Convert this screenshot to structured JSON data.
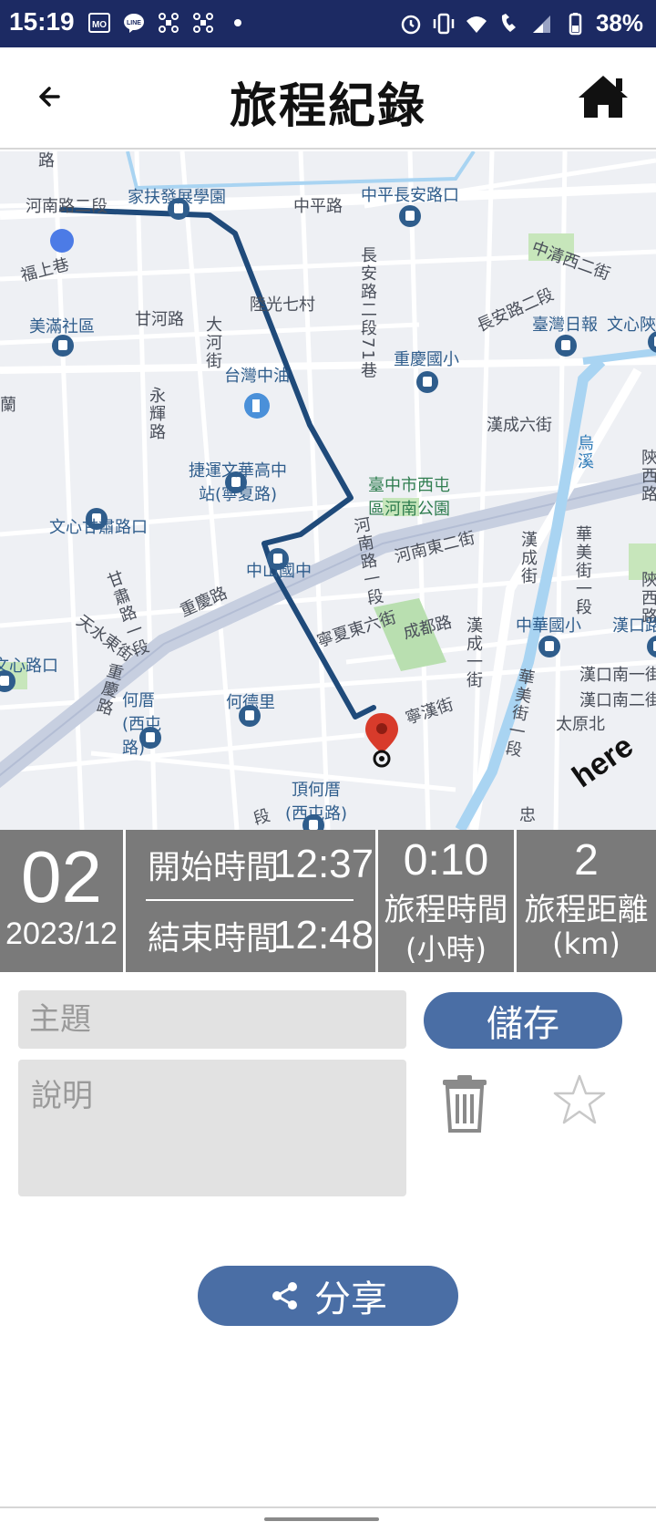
{
  "status_bar": {
    "time": "15:19",
    "battery": "38%",
    "icons": [
      "mo-icon",
      "line-icon",
      "drone-icon",
      "drone-icon",
      "dot-icon",
      "alarm-icon",
      "vibrate-icon",
      "wifi-icon",
      "wifi-call-icon",
      "signal-icon",
      "battery-icon"
    ]
  },
  "header": {
    "title": "旅程紀錄",
    "back_icon": "arrow-left-icon",
    "home_icon": "home-icon"
  },
  "map": {
    "labels": {
      "road_henan2": "河南路二段",
      "jiafu": "家扶發展學園",
      "zhongping": "中平路",
      "zhongping_changan": "中平長安路口",
      "fushang": "福上巷",
      "changan": "長安路二段71巷",
      "zhongqing": "中清西二街",
      "ganhe": "甘河路",
      "dahe": "大河街",
      "luguang": "陸光七村",
      "changan2": "長安路二段",
      "taiwan_daily": "臺灣日報",
      "wenxin_shan": "文心陝",
      "meiman": "美滿社區",
      "chongqing_elem": "重慶國小",
      "yonghui": "永輝路",
      "cpc": "台灣中油",
      "hanchen6": "漢成六街",
      "wuxi": "烏溪",
      "shanxi": "陝西路",
      "jieyun": "捷運文華高中站(寧夏路)",
      "park": "臺中市西屯區河南公園",
      "wenxin_gansu": "文心甘肅路口",
      "henan_e2": "河南東二街",
      "henan1": "河南路一段",
      "hancheng": "漢成街",
      "huamei": "華美街一段",
      "zhongshan": "中山國中",
      "gansu1": "甘肅路一段",
      "chongqing_rd": "重慶路",
      "tianshui_e": "天水東街",
      "ningxia_e6": "寧夏東六街",
      "chengdu": "成都路",
      "hancheng1": "漢成一街",
      "zhonghua_elem": "中華國小",
      "hankou": "漢口路",
      "wenxin_rd": "文心路口",
      "chongqing_rd2": "重慶路",
      "heli_xitun": "何厝(西屯路)",
      "hede": "何德里",
      "ningqian": "寧漢街",
      "hankou_s1": "漢口南一街",
      "hankou_s2": "漢口南二街",
      "taiyuan_n": "太原北",
      "huamei2": "華美街一段",
      "dinghe": "頂何厝(西屯路)",
      "zhong": "忠",
      "duan": "段",
      "lu": "路",
      "lan": "蘭"
    },
    "logo": "here",
    "start_marker_icon": "start-point-icon",
    "end_marker_icon": "end-pin-icon"
  },
  "trip": {
    "day": "02",
    "date": "2023/12",
    "start_label": "開始時間",
    "start_time": "12:37",
    "end_label": "結束時間",
    "end_time": "12:48",
    "duration_value": "0:10",
    "duration_label": "旅程時間",
    "duration_unit": "(小時)",
    "distance_value": "2",
    "distance_label": "旅程距離",
    "distance_unit": "(km)"
  },
  "form": {
    "subject_placeholder": "主題",
    "description_placeholder": "說明",
    "save_label": "儲存",
    "delete_icon": "trash-icon",
    "favorite_icon": "star-icon"
  },
  "share": {
    "label": "分享",
    "icon": "share-icon"
  }
}
